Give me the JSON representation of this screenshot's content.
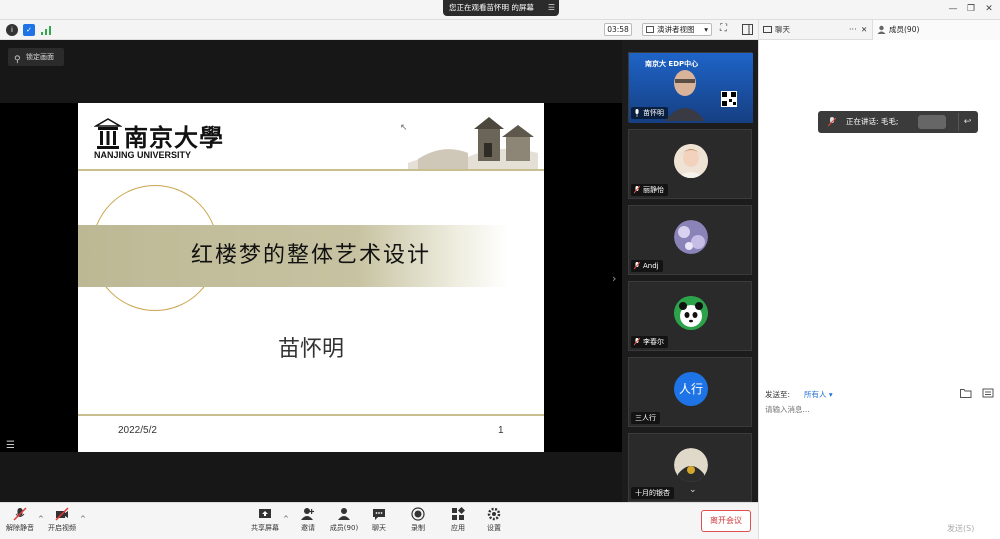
{
  "titlebar": {
    "share_banner": "您正在观看苗怀明 的屏幕",
    "minimize": "—",
    "restore": "❐",
    "close": "✕"
  },
  "videobar": {
    "timer": "03:58",
    "view_mode": "演讲者视图",
    "view_mode_caret": "▾",
    "fullscreen_glyph": "⛶"
  },
  "panel_tabs": {
    "chat": "聊天",
    "chat_more": "···",
    "chat_close": "✕",
    "members": "成员(90)"
  },
  "stage": {
    "pin_label": "锁定画面",
    "expand_arrow": "›"
  },
  "slide": {
    "university_cn": "南京大學",
    "university_en": "NANJING UNIVERSITY",
    "title": "红楼梦的整体艺术设计",
    "author": "苗怀明",
    "date": "2022/5/2",
    "page": "1"
  },
  "gallery": {
    "participants": [
      {
        "name": "苗怀明",
        "banner": "南京大   EDP中心"
      },
      {
        "name": "丽静怡"
      },
      {
        "name": "Andj"
      },
      {
        "name": "李春尔"
      },
      {
        "name": "三人行",
        "avatar_text": "人行"
      },
      {
        "name": "十月的银杏"
      }
    ],
    "scroll_glyph": "⌄"
  },
  "bottombar": {
    "unmute": "解除静音",
    "start_video": "开启视频",
    "share_screen": "共享屏幕",
    "invite": "邀请",
    "members": "成员(90)",
    "chat": "聊天",
    "record": "录制",
    "apps": "应用",
    "settings": "设置",
    "leave": "离开会议",
    "caret": "^"
  },
  "chat": {
    "speaking_label": "正在讲话: 毛毛;",
    "back_glyph": "↩",
    "send_to_label": "发送至:",
    "send_target": "所有人",
    "send_target_caret": "▾",
    "input_placeholder": "请输入消息...",
    "send_button": "发送(S)"
  },
  "colors": {
    "stage_bg": "#171717",
    "accent_gold": "#c9bf8e",
    "avatar_blue": "#1e74e6",
    "leave_red": "#d23a3a",
    "link_blue": "#1f6fd6"
  }
}
